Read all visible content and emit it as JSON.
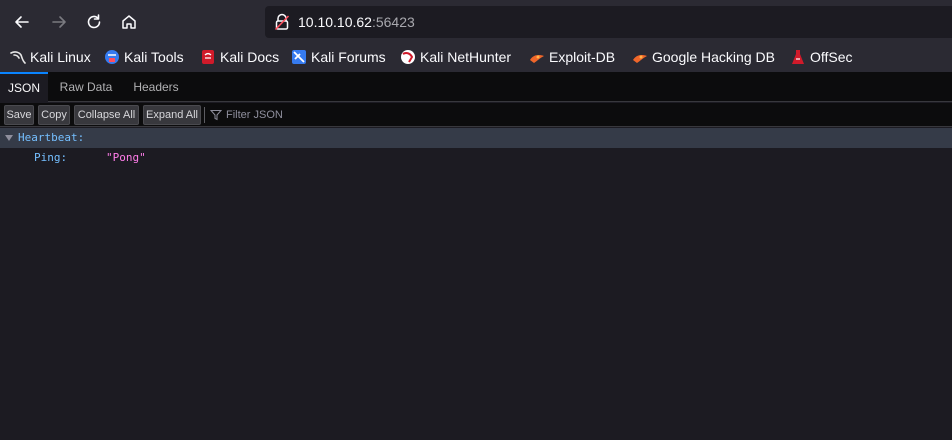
{
  "browser": {
    "url_host": "10.10.10.62",
    "url_port": ":56423"
  },
  "bookmarks": [
    {
      "label": "Kali Linux",
      "icon": "kali-dragon-icon"
    },
    {
      "label": "Kali Tools",
      "icon": "kali-tools-icon"
    },
    {
      "label": "Kali Docs",
      "icon": "kali-docs-icon"
    },
    {
      "label": "Kali Forums",
      "icon": "kali-forums-icon"
    },
    {
      "label": "Kali NetHunter",
      "icon": "kali-nethunter-icon"
    },
    {
      "label": "Exploit-DB",
      "icon": "exploit-db-icon"
    },
    {
      "label": "Google Hacking DB",
      "icon": "google-hacking-db-icon"
    },
    {
      "label": "OffSec",
      "icon": "offsec-icon"
    }
  ],
  "json_viewer": {
    "tabs": [
      {
        "label": "JSON",
        "selected": true
      },
      {
        "label": "Raw Data",
        "selected": false
      },
      {
        "label": "Headers",
        "selected": false
      }
    ],
    "toolbar": {
      "save_label": "Save",
      "copy_label": "Copy",
      "collapse_label": "Collapse All",
      "expand_label": "Expand All",
      "filter_placeholder": "Filter JSON"
    },
    "tree": {
      "parent_key": "Heartbeat:",
      "child_key": "Ping:",
      "child_value": "\"Pong\""
    }
  },
  "colors": {
    "accent": "#0a84ff",
    "key": "#75bfff",
    "string_value": "#ff7de9"
  }
}
